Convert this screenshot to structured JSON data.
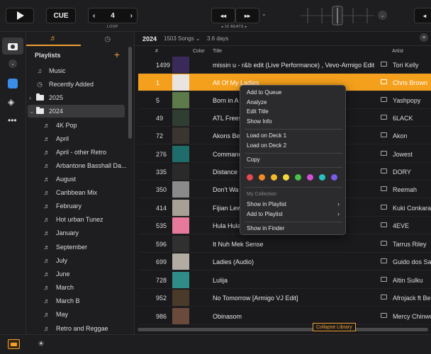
{
  "topbar": {
    "cue_label": "CUE",
    "loop_value": "4",
    "loop_label": "LOOP",
    "beats_label": "16 BEATS"
  },
  "sidebar": {
    "header": "Playlists",
    "items": [
      {
        "label": "Music",
        "icon": "music-note-icon"
      },
      {
        "label": "Recently Added",
        "icon": "clock-icon"
      },
      {
        "label": "2025",
        "icon": "folder-icon"
      },
      {
        "label": "2024",
        "icon": "folder-icon"
      },
      {
        "label": "4K Pop",
        "icon": "playlist-icon"
      },
      {
        "label": "April",
        "icon": "playlist-icon"
      },
      {
        "label": "April - other Retro",
        "icon": "playlist-icon"
      },
      {
        "label": "Arbantone Basshall Da...",
        "icon": "playlist-icon"
      },
      {
        "label": "August",
        "icon": "playlist-icon"
      },
      {
        "label": "Caribbean Mix",
        "icon": "playlist-icon"
      },
      {
        "label": "February",
        "icon": "playlist-icon"
      },
      {
        "label": "Hot urban Tunez",
        "icon": "playlist-icon"
      },
      {
        "label": "January",
        "icon": "playlist-icon"
      },
      {
        "label": "September",
        "icon": "playlist-icon"
      },
      {
        "label": "July",
        "icon": "playlist-icon"
      },
      {
        "label": "June",
        "icon": "playlist-icon"
      },
      {
        "label": "March",
        "icon": "playlist-icon"
      },
      {
        "label": "March B",
        "icon": "playlist-icon"
      },
      {
        "label": "May",
        "icon": "playlist-icon"
      },
      {
        "label": "Retro and Reggae",
        "icon": "playlist-icon"
      }
    ]
  },
  "main": {
    "title": "2024",
    "song_count": "1503 Songs",
    "duration": "3.6 days",
    "columns": {
      "num": "#",
      "color": "Color",
      "title": "Title",
      "artist": "Artist"
    },
    "rows": [
      {
        "num": "1499",
        "title": "missin u - r&b edit (Live Performance) ,  Vevo-Armigo Edit",
        "artist": "Tori Kelly",
        "art": "#3a2a5a"
      },
      {
        "num": "1",
        "title": "All Of My Ladies",
        "artist": "Chris Brown",
        "art": "#e9e4df"
      },
      {
        "num": "5",
        "title": "Born in A",
        "artist": "Yashpopy",
        "art": "#5c7a4a"
      },
      {
        "num": "49",
        "title": "ATL Frees",
        "artist": "6LACK",
        "art": "#2f3d33"
      },
      {
        "num": "72",
        "title": "Akons Bea",
        "artist": "Akon",
        "art": "#3a3530"
      },
      {
        "num": "276",
        "title": "Command",
        "artist": "Jowest",
        "art": "#1e6d6a"
      },
      {
        "num": "335",
        "title": "Distance (",
        "artist": "DORY",
        "art": "#2a2a2a"
      },
      {
        "num": "350",
        "title": "Don't Wa",
        "artist": "Reemah",
        "art": "#8a8a8a"
      },
      {
        "num": "414",
        "title": "Fijian Lew",
        "artist": "Kuki Conkaral",
        "art": "#a7a095"
      },
      {
        "num": "535",
        "title": "Hula Hula",
        "artist": "4EVE",
        "art": "#e77a9c"
      },
      {
        "num": "596",
        "title": "It Nuh Mek Sense",
        "artist": "Tarrus Riley",
        "art": "#303030"
      },
      {
        "num": "699",
        "title": "Ladies (Audio)",
        "artist": "Guido dos San",
        "art": "#b3aca3"
      },
      {
        "num": "728",
        "title": "Lulija",
        "artist": "Altin Sulku",
        "art": "#2f8c86"
      },
      {
        "num": "952",
        "title": "No Tomorrow [Armigo VJ Edit]",
        "artist": "Afrojack ft Be",
        "art": "#4a3a2a"
      },
      {
        "num": "986",
        "title": "Obinasom",
        "artist": "Mercy Chinwo",
        "art": "#6a4a3a"
      }
    ]
  },
  "context_menu": {
    "items": [
      "Add to Queue",
      "Analyze",
      "Edit Title",
      "Show Info",
      "Load on Deck 1",
      "Load on Deck 2",
      "Copy"
    ],
    "colors": [
      "#e8484f",
      "#f08a24",
      "#f5b82a",
      "#f2d83a",
      "#4ac24a",
      "#d24fd8",
      "#26c2c2",
      "#7a5ae8"
    ],
    "section_label": "My Collection",
    "submenu_items": [
      "Show in Playlist",
      "Add to Playlist"
    ],
    "show_in_finder": "Show in Finder"
  },
  "collapse_label": "Collapse Library",
  "colors": {
    "accent": "#f5a01c",
    "background": "#1a1a1c"
  }
}
